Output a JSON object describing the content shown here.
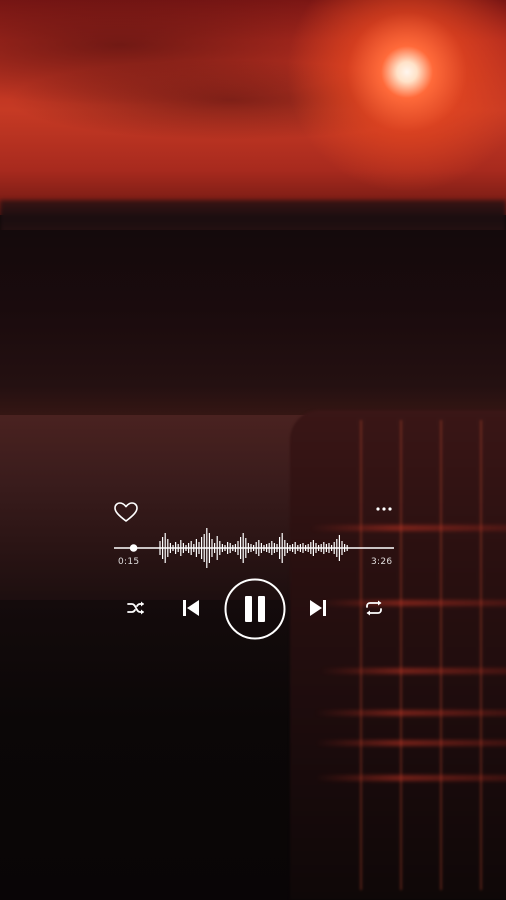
{
  "player": {
    "elapsed_time": "0:15",
    "total_time": "3:26",
    "progress_fraction": 0.07,
    "liked": false,
    "state": "playing"
  },
  "icons": {
    "like": "heart-outline-icon",
    "more": "more-options-icon",
    "shuffle": "shuffle-icon",
    "previous": "skip-previous-icon",
    "play_pause": "pause-icon",
    "next": "skip-next-icon",
    "repeat": "repeat-icon"
  },
  "colors": {
    "ui": "#ffffff",
    "sky_glow": "#c63a24",
    "background": "#0b0707"
  }
}
